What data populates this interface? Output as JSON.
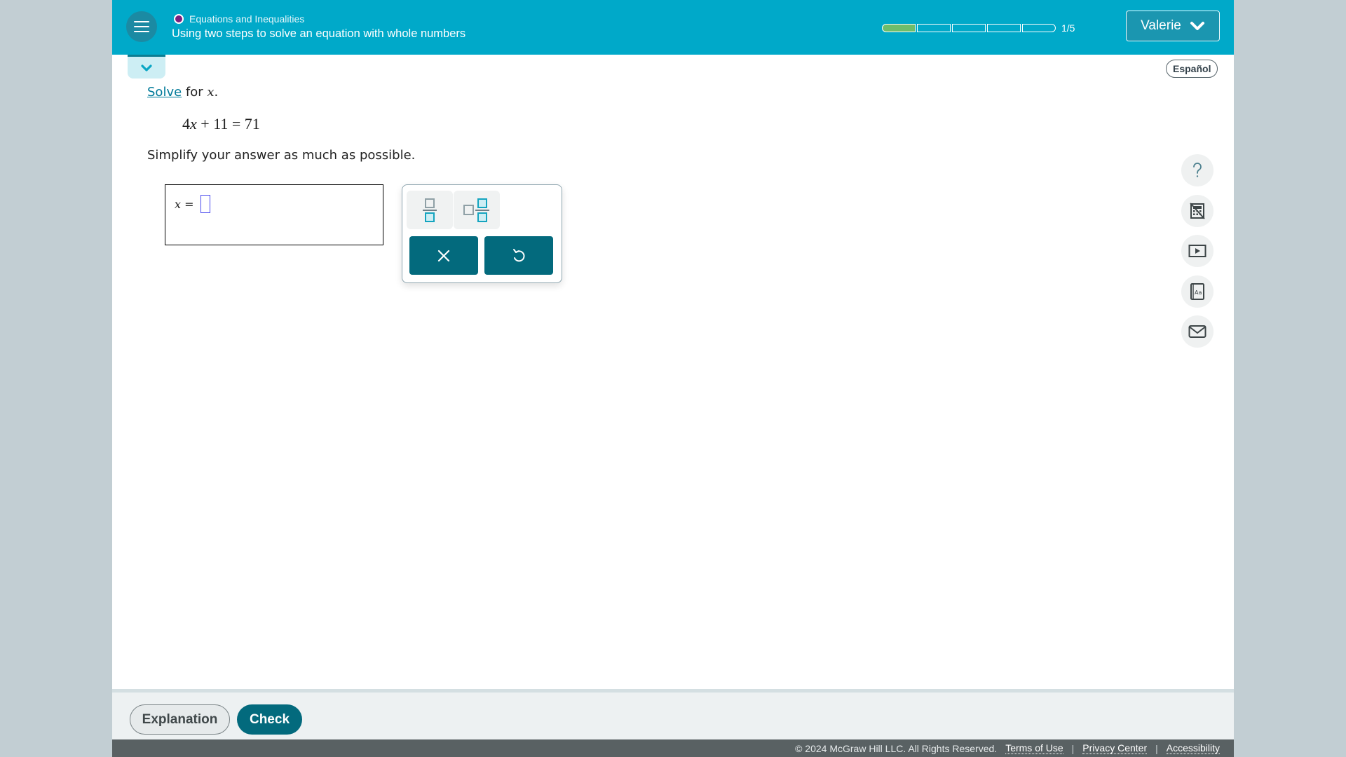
{
  "header": {
    "topic": "Equations and Inequalities",
    "topic_color": "#7b1f7e",
    "lesson_title": "Using two steps to solve an equation with whole numbers",
    "progress": {
      "completed": 1,
      "total": 5,
      "label": "1/5"
    },
    "user_name": "Valerie",
    "menu_icon": "hamburger-icon",
    "user_chevron_icon": "chevron-down-icon"
  },
  "collapse_tab": {
    "icon": "chevron-down-icon"
  },
  "language_button": "Español",
  "problem": {
    "instruction_link": "Solve",
    "instruction_rest": " for ",
    "instruction_var": "x",
    "instruction_end": ".",
    "equation": {
      "coef": "4",
      "var": "x",
      "op": " + ",
      "const": "11",
      "eq": " = ",
      "rhs": "71"
    },
    "simplify_text": "Simplify your answer as much as possible."
  },
  "answer": {
    "variable": "x",
    "equals": " =",
    "value": ""
  },
  "keypad": {
    "templates": [
      {
        "name": "fraction-template",
        "icon": "fraction-icon"
      },
      {
        "name": "mixed-number-template",
        "icon": "mixed-number-icon"
      }
    ],
    "actions": [
      {
        "name": "clear",
        "icon": "close-icon"
      },
      {
        "name": "undo",
        "icon": "undo-icon"
      }
    ]
  },
  "tools": [
    {
      "name": "help",
      "icon": "question-icon"
    },
    {
      "name": "calculator",
      "icon": "calculator-disabled-icon"
    },
    {
      "name": "video",
      "icon": "video-icon"
    },
    {
      "name": "glossary",
      "icon": "glossary-book-icon"
    },
    {
      "name": "message",
      "icon": "mail-icon"
    }
  ],
  "bottom": {
    "explanation_label": "Explanation",
    "check_label": "Check"
  },
  "footer": {
    "copyright": "© 2024 McGraw Hill LLC. All Rights Reserved.",
    "links": [
      "Terms of Use",
      "Privacy Center",
      "Accessibility"
    ],
    "separator": "|"
  },
  "colors": {
    "header_bg": "#00a9c9",
    "primary_button": "#036a7d",
    "progress_fill": "#6dbd6a",
    "footer_bg": "#596163"
  }
}
